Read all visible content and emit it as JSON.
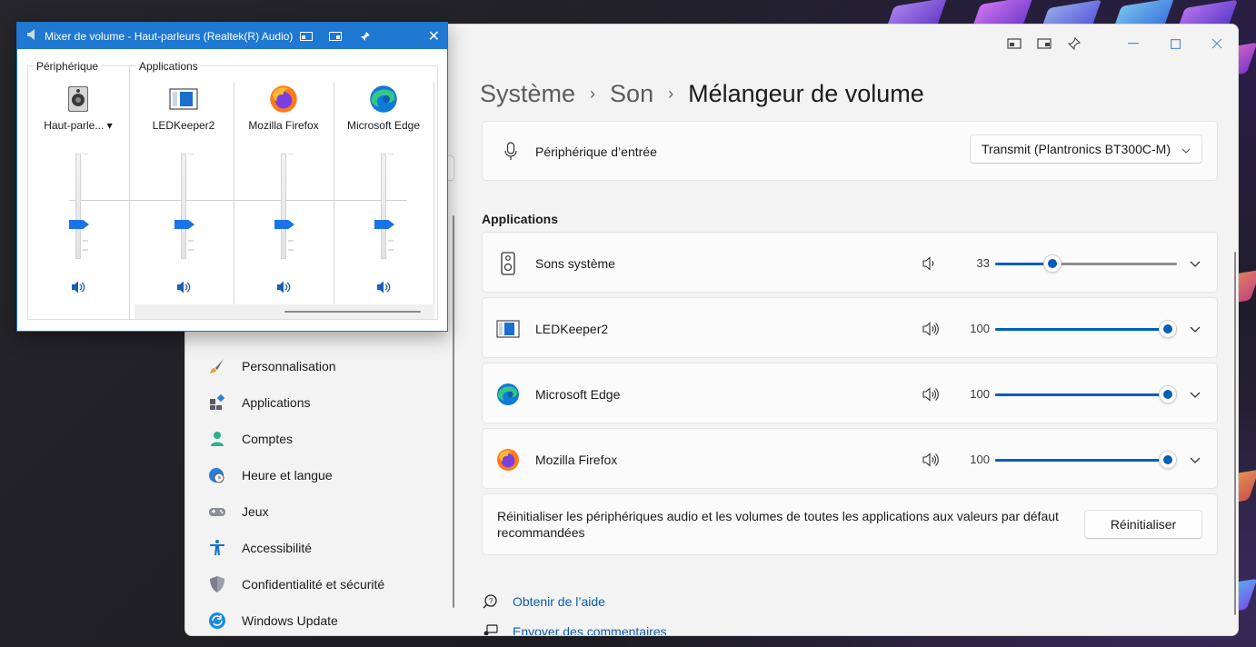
{
  "mixer": {
    "title": "Mixer de volume - Haut-parleurs (Realtek(R) Audio)",
    "device_group_label": "Périphérique",
    "apps_group_label": "Applications",
    "device_name": "Haut-parle...",
    "dropdown_arrow": "▾",
    "apps": [
      {
        "name": "LEDKeeper2"
      },
      {
        "name": "Mozilla Firefox"
      },
      {
        "name": "Microsoft Edge"
      }
    ],
    "close_glyph": "✕"
  },
  "settings": {
    "breadcrumb": [
      "Système",
      "Son",
      "Mélangeur de volume"
    ],
    "breadcrumb_sep": "›",
    "input_device": {
      "label": "Périphérique d’entrée",
      "value": "Transmit (Plantronics BT300C-M)"
    },
    "applications_title": "Applications",
    "apps": [
      {
        "name": "Sons système",
        "volume": 33,
        "volume_text": "33"
      },
      {
        "name": "LEDKeeper2",
        "volume": 100,
        "volume_text": "100"
      },
      {
        "name": "Microsoft Edge",
        "volume": 100,
        "volume_text": "100"
      },
      {
        "name": "Mozilla Firefox",
        "volume": 100,
        "volume_text": "100"
      }
    ],
    "reset": {
      "text": "Réinitialiser les périphériques audio et les volumes de toutes les applications aux valeurs par défaut recommandées",
      "button": "Réinitialiser"
    },
    "links": {
      "help": "Obtenir de l’aide",
      "feedback": "Envoyer des commentaires"
    },
    "nav": [
      {
        "label": "Personnalisation",
        "icon": "brush-icon"
      },
      {
        "label": "Applications",
        "icon": "apps-icon"
      },
      {
        "label": "Comptes",
        "icon": "person-icon"
      },
      {
        "label": "Heure et langue",
        "icon": "globe-clock-icon"
      },
      {
        "label": "Jeux",
        "icon": "gamepad-icon"
      },
      {
        "label": "Accessibilité",
        "icon": "accessibility-icon"
      },
      {
        "label": "Confidentialité et sécurité",
        "icon": "shield-icon"
      },
      {
        "label": "Windows Update",
        "icon": "update-icon"
      }
    ]
  },
  "colors": {
    "accent": "#005fb8",
    "mixer_title_bar": "#1f78d1",
    "link": "#0b5cad"
  }
}
